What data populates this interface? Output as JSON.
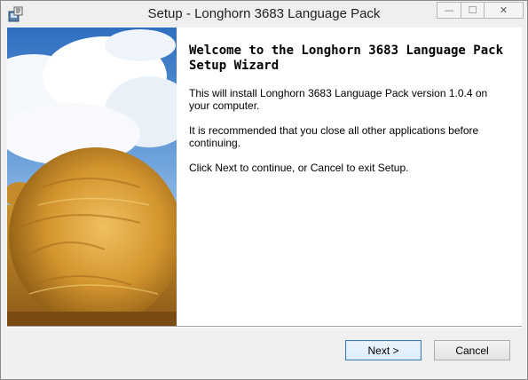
{
  "window": {
    "title": "Setup - Longhorn 3683 Language Pack",
    "controls": {
      "minimize": "—",
      "maximize": "☐",
      "close": "✕"
    }
  },
  "wizard": {
    "heading": "Welcome to the Longhorn 3683 Language Pack Setup Wizard",
    "paragraphs": [
      "This will install Longhorn 3683 Language Pack version 1.0.4 on your computer.",
      "It is recommended that you close all other applications before continuing.",
      "Click Next to continue, or Cancel to exit Setup."
    ]
  },
  "buttons": {
    "next": "Next >",
    "cancel": "Cancel"
  },
  "icons": {
    "app": "setup-app-icon",
    "side_image": "hay-bale-photo"
  },
  "colors": {
    "sky": "#3f7fc8",
    "hay": "#c98a2a",
    "focus_border": "#3c7fb1"
  }
}
